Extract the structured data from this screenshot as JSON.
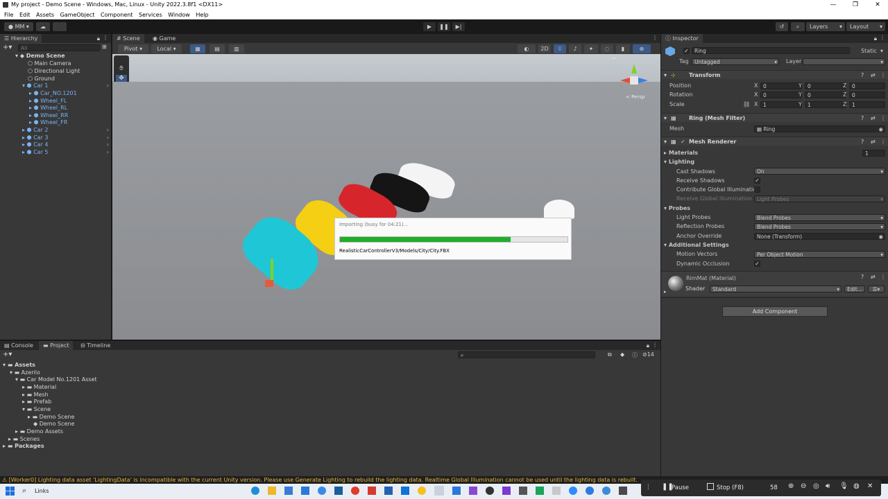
{
  "window": {
    "title": "My project - Demo Scene - Windows, Mac, Linux - Unity 2022.3.8f1 <DX11>",
    "controls": [
      "—",
      "❐",
      "✕"
    ]
  },
  "menu": [
    "File",
    "Edit",
    "Assets",
    "GameObject",
    "Component",
    "Services",
    "Window",
    "Help"
  ],
  "toolbar": {
    "account": "MM",
    "layers": "Layers",
    "layout": "Layout"
  },
  "hierarchy": {
    "tab": "Hierarchy",
    "search_placeholder": "All",
    "items": [
      {
        "label": "Demo Scene"
      },
      {
        "label": "Main Camera"
      },
      {
        "label": "Directional Light"
      },
      {
        "label": "Ground"
      },
      {
        "label": "Car 1"
      },
      {
        "label": "Car_NO.1201"
      },
      {
        "label": "Wheel_FL"
      },
      {
        "label": "Wheel_RL"
      },
      {
        "label": "Wheel_RR"
      },
      {
        "label": "Wheel_FR"
      },
      {
        "label": "Car 2"
      },
      {
        "label": "Car 3"
      },
      {
        "label": "Car 4"
      },
      {
        "label": "Car 5"
      }
    ]
  },
  "scene": {
    "tabs": [
      "Scene",
      "Game"
    ],
    "pivot": "Pivot",
    "local": "Local",
    "mode_2d": "2D",
    "persp": "< Persp"
  },
  "import": {
    "title": "Importing (busy for 04:21)...",
    "progress": 0.75,
    "path": "RealisticCarControllerV3/Models/City/City.FBX"
  },
  "inspector": {
    "tab": "Inspector",
    "object_name": "Ring",
    "static": "Static",
    "tag_label": "Tag",
    "tag": "Untagged",
    "layer_label": "Layer",
    "transform": {
      "header": "Transform",
      "position_label": "Position",
      "position": [
        "0",
        "0",
        "0"
      ],
      "rotation_label": "Rotation",
      "rotation": [
        "0",
        "0",
        "0"
      ],
      "scale_label": "Scale",
      "scale": [
        "1",
        "1",
        "1"
      ]
    },
    "mesh_filter": {
      "header": "Ring (Mesh Filter)",
      "mesh_label": "Mesh",
      "mesh": "Ring"
    },
    "mesh_renderer": {
      "header": "Mesh Renderer",
      "materials": "Materials",
      "materials_count": "1",
      "lighting": "Lighting",
      "cast_shadows": "Cast Shadows",
      "cast_shadows_value": "On",
      "receive_shadows": "Receive Shadows",
      "contribute_gi": "Contribute Global Illumination",
      "receive_gi": "Receive Global Illumination",
      "receive_gi_value": "Light Probes",
      "probes": "Probes",
      "light_probes": "Light Probes",
      "light_probes_value": "Blend Probes",
      "reflection_probes": "Reflection Probes",
      "reflection_probes_value": "Blend Probes",
      "anchor_override": "Anchor Override",
      "anchor_override_value": "None (Transform)",
      "additional": "Additional Settings",
      "motion_vectors": "Motion Vectors",
      "motion_vectors_value": "Per Object Motion",
      "dynamic_occlusion": "Dynamic Occlusion"
    },
    "material": {
      "name": "RimMat (Material)",
      "shader_label": "Shader",
      "shader": "Standard",
      "edit": "Edit..."
    },
    "add_component": "Add Component"
  },
  "bottom": {
    "tabs": [
      "Console",
      "Project",
      "Timeline"
    ],
    "hidden_count": "14",
    "tree": [
      {
        "label": "Assets"
      },
      {
        "label": "Azerilo"
      },
      {
        "label": "Car Model No.1201 Asset"
      },
      {
        "label": "Material"
      },
      {
        "label": "Mesh"
      },
      {
        "label": "Prefab"
      },
      {
        "label": "Scene"
      },
      {
        "label": "Demo Scene"
      },
      {
        "label": "Demo Scene"
      },
      {
        "label": "Demo Assets"
      },
      {
        "label": "Scenes"
      },
      {
        "label": "Packages"
      }
    ]
  },
  "status": "[Worker0] Lighting data asset 'LightingData' is incompatible with the current Unity version. Please use Generate Lighting to rebuild the lighting data. Realtime Global Illumination cannot be used until the lighting data is rebuilt.",
  "taskbar": {
    "search": "Links",
    "pause": "Pause",
    "stop": "Stop",
    "stop_key": "(F8)",
    "timer": "58"
  }
}
